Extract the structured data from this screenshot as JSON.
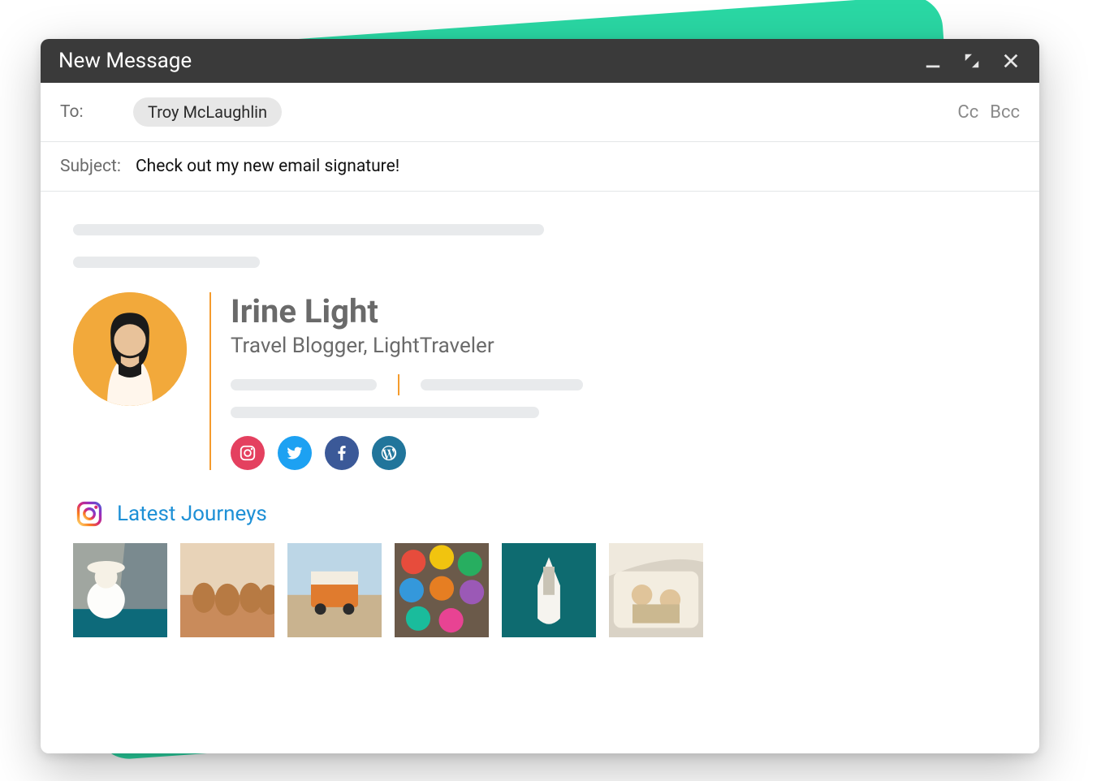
{
  "window": {
    "title": "New Message"
  },
  "fields": {
    "to_label": "To:",
    "recipient": "Troy McLaughlin",
    "cc_label": "Cc",
    "bcc_label": "Bcc",
    "subject_label": "Subject:",
    "subject_value": "Check out my new email signature!"
  },
  "signature": {
    "name": "Irine Light",
    "role": "Travel Blogger, LightTraveler",
    "gallery_title": "Latest Journeys",
    "social": {
      "instagram": "instagram",
      "twitter": "twitter",
      "facebook": "facebook",
      "wordpress": "wordpress"
    },
    "accent_color": "#f59b2d"
  }
}
